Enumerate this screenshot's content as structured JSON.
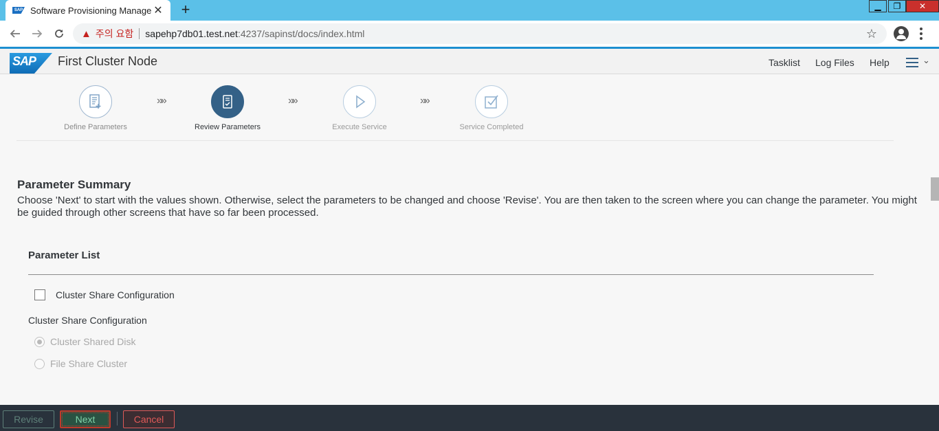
{
  "browser": {
    "tab_title": "Software Provisioning Manager",
    "tab_close": "✕",
    "new_tab": "+",
    "win_min": "▁",
    "win_max": "❐",
    "win_close": "✕",
    "security_warning": "주의 요함",
    "url_host": "sapehp7db01.test.net",
    "url_path": ":4237/sapinst/docs/index.html"
  },
  "shell": {
    "logo_text": "SAP",
    "title": "First Cluster Node",
    "links": {
      "tasklist": "Tasklist",
      "log_files": "Log Files",
      "help": "Help"
    }
  },
  "wizard": {
    "steps": [
      {
        "label": "Define Parameters",
        "icon": "define-parameters-icon",
        "state": "done"
      },
      {
        "label": "Review Parameters",
        "icon": "review-parameters-icon",
        "state": "active"
      },
      {
        "label": "Execute Service",
        "icon": "play-icon",
        "state": "pending"
      },
      {
        "label": "Service Completed",
        "icon": "checkmark-icon",
        "state": "pending"
      }
    ],
    "separator": "»»"
  },
  "content": {
    "heading": "Parameter Summary",
    "description": "Choose 'Next' to start with the values shown. Otherwise, select the parameters to be changed and choose 'Revise'. You are then taken to the screen where you can change the parameter. You might be guided through other screens that have so far been processed.",
    "list_heading": "Parameter List",
    "checkbox_label": "Cluster Share Configuration",
    "checkbox_checked": false,
    "group_label": "Cluster Share Configuration",
    "radio_options": [
      {
        "label": "Cluster Shared Disk",
        "selected": true
      },
      {
        "label": "File Share Cluster",
        "selected": false
      }
    ]
  },
  "footer": {
    "revise": "Revise",
    "next": "Next",
    "cancel": "Cancel"
  },
  "colors": {
    "shell_accent": "#1d8fd1",
    "active_step": "#346187",
    "footer_bg": "#29323c",
    "next_button": "#7fd3a8",
    "cancel_button": "#e05a58"
  }
}
